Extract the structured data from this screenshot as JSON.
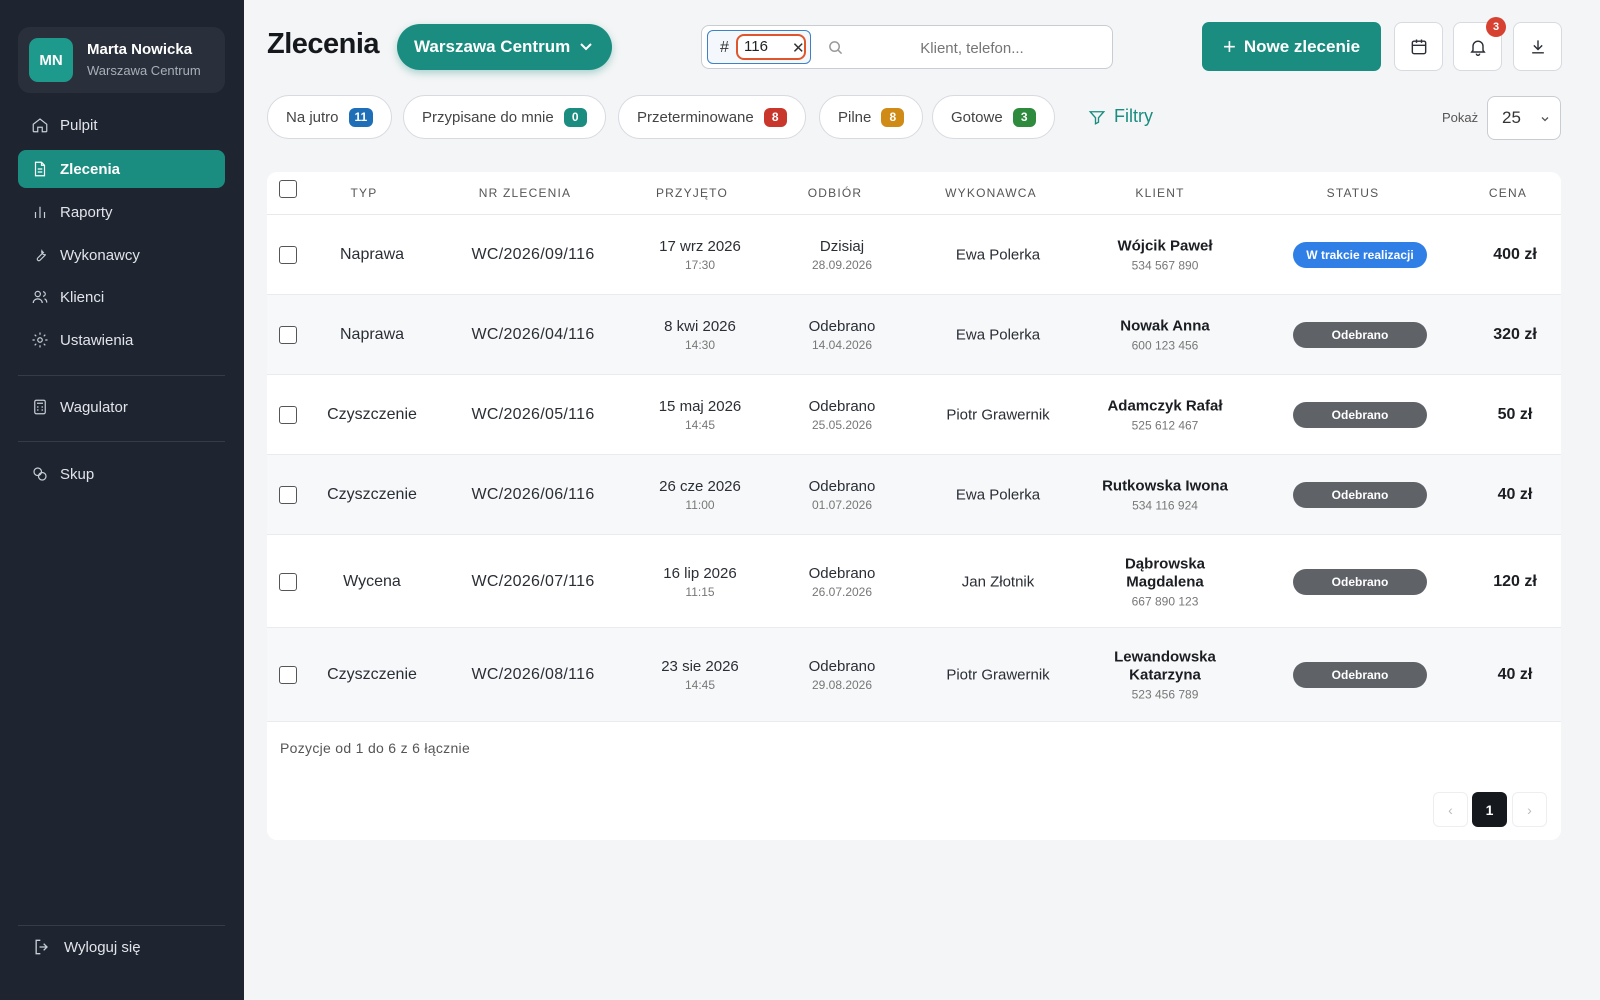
{
  "sidebar": {
    "user": {
      "initials": "MN",
      "name": "Marta Nowicka",
      "branch": "Warszawa Centrum"
    },
    "items": [
      {
        "label": "Pulpit",
        "icon": "home-icon"
      },
      {
        "label": "Zlecenia",
        "icon": "document-icon",
        "active": true
      },
      {
        "label": "Raporty",
        "icon": "bar-chart-icon"
      },
      {
        "label": "Wykonawcy",
        "icon": "wrench-icon"
      },
      {
        "label": "Klienci",
        "icon": "users-icon"
      },
      {
        "label": "Ustawienia",
        "icon": "gear-icon"
      },
      {
        "label": "Wagulator",
        "icon": "calculator-icon"
      },
      {
        "label": "Skup",
        "icon": "coins-icon"
      }
    ],
    "logout_label": "Wyloguj się"
  },
  "header": {
    "title": "Zlecenia",
    "branch_select": "Warszawa Centrum",
    "order_number_prefix": "#",
    "order_number_value": "116",
    "search_placeholder": "Klient, telefon...",
    "new_order_label": "Nowe zlecenie",
    "notifications_count": "3"
  },
  "filters": {
    "pills": [
      {
        "label": "Na jutro",
        "count": "11",
        "color": "#1f6fb8"
      },
      {
        "label": "Przypisane do mnie",
        "count": "0",
        "color": "#1a8d80"
      },
      {
        "label": "Przeterminowane",
        "count": "8",
        "color": "#c9372c"
      },
      {
        "label": "Pilne",
        "count": "8",
        "color": "#d08a16"
      },
      {
        "label": "Gotowe",
        "count": "3",
        "color": "#2e8b3e"
      }
    ],
    "filters_label": "Filtry",
    "show_label": "Pokaż",
    "page_size": "25"
  },
  "table": {
    "headers": {
      "type": "TYP",
      "number": "NR ZLECENIA",
      "received": "PRZYJĘTO",
      "pickup": "ODBIÓR",
      "contractor": "WYKONAWCA",
      "client": "KLIENT",
      "status": "STATUS",
      "price": "CENA"
    },
    "rows": [
      {
        "type": "Naprawa",
        "number": "WC/2026/09/116",
        "received_date": "17 wrz 2026",
        "received_time": "17:30",
        "pickup_main": "Dzisiaj",
        "pickup_date": "28.09.2026",
        "contractor": "Ewa Polerka",
        "client_line1": "Wójcik Paweł",
        "client_line2": "",
        "phone": "534 567 890",
        "status": "W trakcie realizacji",
        "status_color": "#2f7fe6",
        "price": "400 zł"
      },
      {
        "type": "Naprawa",
        "number": "WC/2026/04/116",
        "received_date": "8 kwi 2026",
        "received_time": "14:30",
        "pickup_main": "Odebrano",
        "pickup_date": "14.04.2026",
        "contractor": "Ewa Polerka",
        "client_line1": "Nowak Anna",
        "client_line2": "",
        "phone": "600 123 456",
        "status": "Odebrano",
        "status_color": "#5f6368",
        "price": "320 zł"
      },
      {
        "type": "Czyszczenie",
        "number": "WC/2026/05/116",
        "received_date": "15 maj 2026",
        "received_time": "14:45",
        "pickup_main": "Odebrano",
        "pickup_date": "25.05.2026",
        "contractor": "Piotr Grawernik",
        "client_line1": "Adamczyk Rafał",
        "client_line2": "",
        "phone": "525 612 467",
        "status": "Odebrano",
        "status_color": "#5f6368",
        "price": "50 zł"
      },
      {
        "type": "Czyszczenie",
        "number": "WC/2026/06/116",
        "received_date": "26 cze 2026",
        "received_time": "11:00",
        "pickup_main": "Odebrano",
        "pickup_date": "01.07.2026",
        "contractor": "Ewa Polerka",
        "client_line1": "Rutkowska Iwona",
        "client_line2": "",
        "phone": "534 116 924",
        "status": "Odebrano",
        "status_color": "#5f6368",
        "price": "40 zł"
      },
      {
        "type": "Wycena",
        "number": "WC/2026/07/116",
        "received_date": "16 lip 2026",
        "received_time": "11:15",
        "pickup_main": "Odebrano",
        "pickup_date": "26.07.2026",
        "contractor": "Jan Złotnik",
        "client_line1": "Dąbrowska",
        "client_line2": "Magdalena",
        "phone": "667 890 123",
        "status": "Odebrano",
        "status_color": "#5f6368",
        "price": "120 zł"
      },
      {
        "type": "Czyszczenie",
        "number": "WC/2026/08/116",
        "received_date": "23 sie 2026",
        "received_time": "14:45",
        "pickup_main": "Odebrano",
        "pickup_date": "29.08.2026",
        "contractor": "Piotr Grawernik",
        "client_line1": "Lewandowska",
        "client_line2": "Katarzyna",
        "phone": "523 456 789",
        "status": "Odebrano",
        "status_color": "#5f6368",
        "price": "40 zł"
      }
    ],
    "footer_text": "Pozycje od 1 do 6 z 6 łącznie",
    "pagination": {
      "prev": "‹",
      "current": "1",
      "next": "›"
    }
  }
}
